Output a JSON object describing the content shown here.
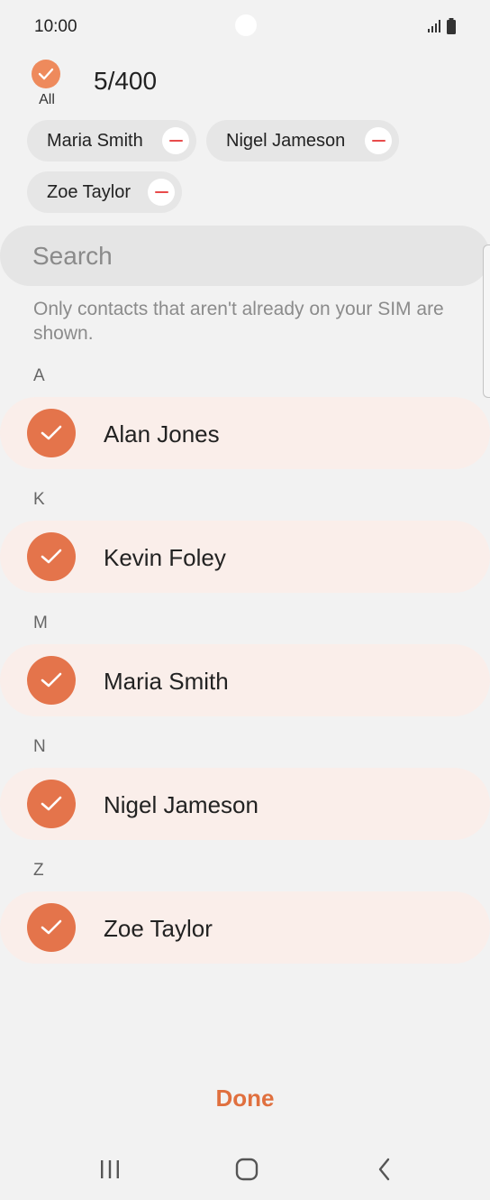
{
  "status_bar": {
    "time": "10:00",
    "signal_icon": "signal-bars-icon",
    "battery_icon": "battery-full-icon"
  },
  "selection": {
    "all_label": "All",
    "count": "5/400"
  },
  "chips": [
    {
      "label": "Maria Smith",
      "remove_icon": "minus-circle-icon"
    },
    {
      "label": "Nigel Jameson",
      "remove_icon": "minus-circle-icon"
    },
    {
      "label": "Zoe Taylor",
      "remove_icon": "minus-circle-icon"
    }
  ],
  "search": {
    "placeholder": "Search",
    "value": ""
  },
  "info_text": "Only contacts that aren't already on your SIM are shown.",
  "sections": [
    {
      "letter": "A",
      "contact": {
        "name": "Alan Jones",
        "checked": true
      }
    },
    {
      "letter": "K",
      "contact": {
        "name": "Kevin Foley",
        "checked": true
      }
    },
    {
      "letter": "M",
      "contact": {
        "name": "Maria Smith",
        "checked": true
      }
    },
    {
      "letter": "N",
      "contact": {
        "name": "Nigel Jameson",
        "checked": true
      }
    },
    {
      "letter": "Z",
      "contact": {
        "name": "Zoe Taylor",
        "checked": true
      }
    }
  ],
  "done_label": "Done",
  "nav": {
    "recents_icon": "recents-icon",
    "home_icon": "home-icon",
    "back_icon": "back-icon"
  },
  "colors": {
    "accent": "#e0703f",
    "check_fill": "#e4744b",
    "selected_row": "#faeeea",
    "chip_bg": "#e6e6e6",
    "remove_red": "#e84b4b",
    "background": "#f2f2f2"
  }
}
